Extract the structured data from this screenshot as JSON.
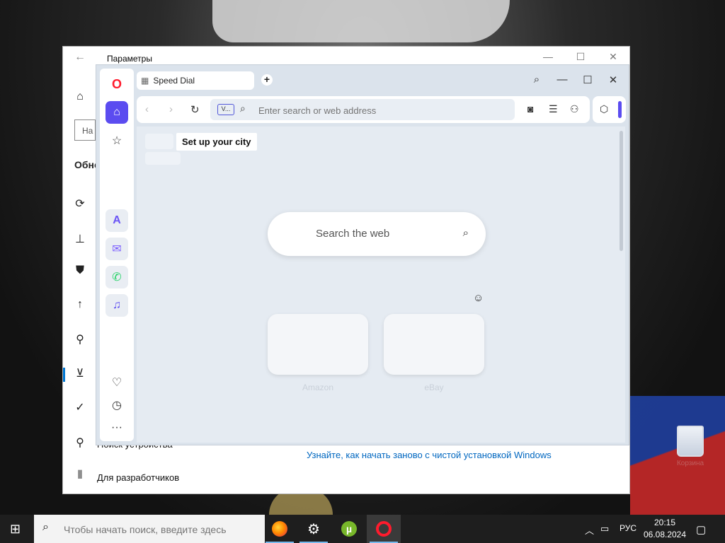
{
  "settings": {
    "title": "Параметры",
    "nav_icons": [
      "home-icon",
      "sync-icon",
      "backup-icon",
      "shield-icon",
      "upload-icon",
      "wrench-icon",
      "recovery-icon",
      "check-icon",
      "person-icon",
      "developer-icon"
    ],
    "partial_search": "На",
    "partial_heading": "Обно",
    "partial_item": "Поиск устройства",
    "developers_label": "Для разработчиков",
    "reinstall_link": "Узнайте, как начать заново с чистой установкой Windows"
  },
  "opera": {
    "tab_label": "Speed Dial",
    "vpn_label": "V...",
    "address_placeholder": "Enter search or web address",
    "city_tip": "Set up your city",
    "search_placeholder": "Search the web",
    "tiles": [
      {
        "label": "Amazon"
      },
      {
        "label": "eBay"
      }
    ],
    "accent": "#5b4cf0"
  },
  "taskbar": {
    "search_placeholder": "Чтобы начать поиск, введите здесь",
    "lang": "РУС",
    "time": "20:15",
    "date": "06.08.2024"
  },
  "desktop": {
    "recycle_label": "Корзина"
  }
}
